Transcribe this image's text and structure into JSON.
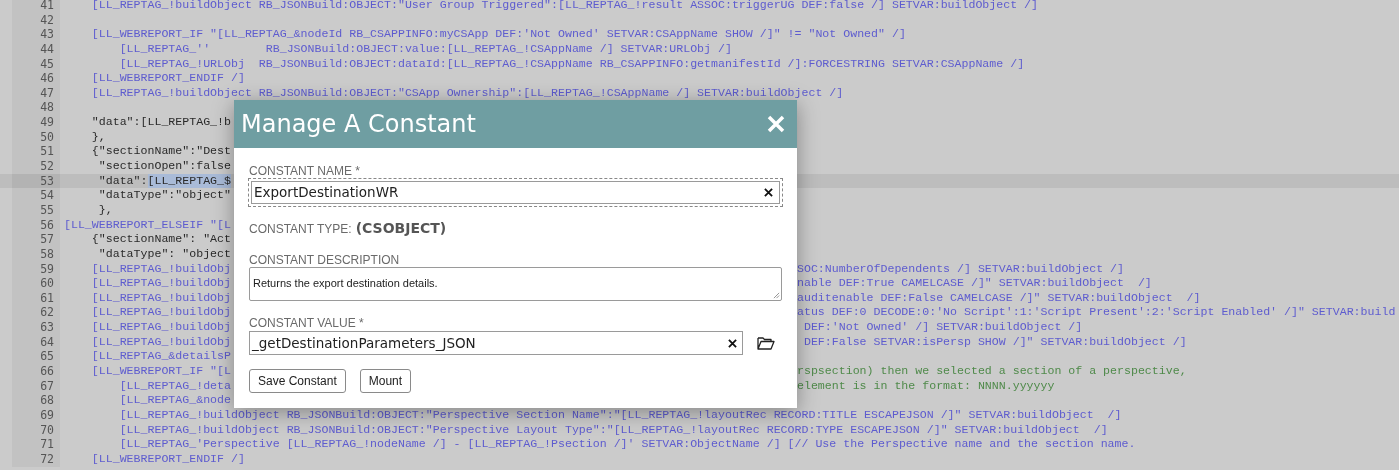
{
  "editor": {
    "lines": [
      {
        "number": "41",
        "highlighted": false,
        "kind": "tag",
        "text": "    [LL_REPTAG_!buildObject RB_JSONBuild:OBJECT:\"User Group Triggered\":[LL_REPTAG_!result ASSOC:triggerUG DEF:false /] SETVAR:buildObject /]"
      },
      {
        "number": "42",
        "highlighted": false
      },
      {
        "number": "43",
        "highlighted": false,
        "kind": "tag",
        "text": "    [LL_WEBREPORT_IF \"[LL_REPTAG_&nodeId RB_CSAPPINFO:myCSApp DEF:'Not Owned' SETVAR:CSAppName SHOW /]\" != \"Not Owned\" /]"
      },
      {
        "number": "44",
        "highlighted": false,
        "kind": "tag",
        "text": "        [LL_REPTAG_''        RB_JSONBuild:OBJECT:value:[LL_REPTAG_!CSAppName /] SETVAR:URLObj /]"
      },
      {
        "number": "45",
        "highlighted": false,
        "kind": "tag",
        "text": "        [LL_REPTAG_!URLObj  RB_JSONBuild:OBJECT:dataId:[LL_REPTAG_!CSAppName RB_CSAPPINFO:getmanifestId /]:FORCESTRING SETVAR:CSAppName /]"
      },
      {
        "number": "46",
        "highlighted": false,
        "kind": "tag",
        "text": "    [LL_WEBREPORT_ENDIF /]"
      },
      {
        "number": "47",
        "highlighted": false,
        "kind": "tag",
        "text": "    [LL_REPTAG_!buildObject RB_JSONBuild:OBJECT:\"CSApp Ownership\":[LL_REPTAG_!CSAppName /] SETVAR:buildObject /]"
      },
      {
        "number": "48",
        "highlighted": false
      },
      {
        "number": "49",
        "highlighted": false,
        "kind": "json",
        "text": "    \"data\":[LL_REPTAG_!b"
      },
      {
        "number": "50",
        "highlighted": false,
        "kind": "json",
        "text": "    },"
      },
      {
        "number": "51",
        "highlighted": false,
        "kind": "json",
        "text": "    {\"sectionName\":\"Dest"
      },
      {
        "number": "52",
        "highlighted": false,
        "kind": "json",
        "text": "     \"sectionOpen\":false"
      },
      {
        "number": "53",
        "highlighted": true,
        "kind": "json",
        "text": "     \"data\":",
        "selection": "[LL_REPTAG_$"
      },
      {
        "number": "54",
        "highlighted": false,
        "kind": "json",
        "text": "     \"dataType\":\"object\""
      },
      {
        "number": "55",
        "highlighted": false,
        "kind": "json",
        "text": "     },"
      },
      {
        "number": "56",
        "highlighted": false,
        "kind": "tag",
        "text": "[LL_WEBREPORT_ELSEIF \"[L"
      },
      {
        "number": "57",
        "highlighted": false,
        "kind": "json",
        "text": "    {\"sectionName\": \"Act"
      },
      {
        "number": "58",
        "highlighted": false,
        "kind": "json",
        "text": "     \"dataType\": \"object"
      },
      {
        "number": "59",
        "highlighted": false,
        "kind": "tag",
        "text": "    [LL_REPTAG_!buildObj",
        "right": {
          "kind": "tag",
          "text": "SOC:NumberOfDependents /] SETVAR:buildObject /]"
        }
      },
      {
        "number": "60",
        "highlighted": false,
        "kind": "tag",
        "text": "    [LL_REPTAG_!buildObj",
        "right": {
          "kind": "tag",
          "text": "nable DEF:True CAMELCASE /]\" SETVAR:buildObject  /]"
        }
      },
      {
        "number": "61",
        "highlighted": false,
        "kind": "tag",
        "text": "    [LL_REPTAG_!buildObj",
        "right": {
          "kind": "tag",
          "text": "auditenable DEF:False CAMELCASE /]\" SETVAR:buildObject  /]"
        }
      },
      {
        "number": "62",
        "highlighted": false,
        "kind": "tag",
        "text": "    [LL_REPTAG_!buildObj",
        "right": {
          "kind": "tag",
          "text": "atus DEF:0 DECODE:0:'No Script':1:'Script Present':2:'Script Enabled' /]\" SETVAR:build"
        }
      },
      {
        "number": "63",
        "highlighted": false,
        "kind": "tag",
        "text": "    [LL_REPTAG_!buildObj",
        "right": {
          "kind": "tag",
          "text": " DEF:'Not Owned' /] SETVAR:buildObject /]"
        }
      },
      {
        "number": "64",
        "highlighted": false,
        "kind": "tag",
        "text": "    [LL_REPTAG_!buildObj",
        "right": {
          "kind": "tag",
          "text": " DEF:False SETVAR:isPersp SHOW /]\" SETVAR:buildObject /]"
        }
      },
      {
        "number": "65",
        "highlighted": false,
        "kind": "tag",
        "text": "    [LL_REPTAG_&detailsP"
      },
      {
        "number": "66",
        "highlighted": false,
        "kind": "tag",
        "text": "    [LL_WEBREPORT_IF \"[L",
        "right": {
          "kind": "comment",
          "text": "rspsection) then we selected a section of a perspective,"
        }
      },
      {
        "number": "67",
        "highlighted": false,
        "kind": "tag",
        "text": "        [LL_REPTAG_!deta",
        "right": {
          "kind": "comment",
          "text": "element is in the format: NNNN.yyyyyy"
        }
      },
      {
        "number": "68",
        "highlighted": false,
        "kind": "tag",
        "text": "        [LL_REPTAG_&node"
      },
      {
        "number": "69",
        "highlighted": false,
        "kind": "tag",
        "text": "        [LL_REPTAG_!buildObject RB_JSONBuild:OBJECT:\"Perspective Section Name\":\"[LL_REPTAG_!layoutRec RECORD:TITLE ESCAPEJSON /]\" SETVAR:buildObject  /]"
      },
      {
        "number": "70",
        "highlighted": false,
        "kind": "tag",
        "text": "        [LL_REPTAG_!buildObject RB_JSONBuild:OBJECT:\"Perspective Layout Type\":\"[LL_REPTAG_!layoutRec RECORD:TYPE ESCAPEJSON /]\" SETVAR:buildObject  /]"
      },
      {
        "number": "71",
        "highlighted": false,
        "kind": "tag",
        "text": "        [LL_REPTAG_'Perspective [LL_REPTAG_!nodeName /] - [LL_REPTAG_!Psection /]' SETVAR:ObjectName /] [// Use the Perspective name and the section name."
      },
      {
        "number": "72",
        "highlighted": false,
        "kind": "tag",
        "text": "    [LL_WEBREPORT_ENDIF /]"
      }
    ]
  },
  "dialog": {
    "title": "Manage A Constant",
    "name_field": {
      "label": "CONSTANT NAME *",
      "value": "ExportDestinationWR",
      "focused": true
    },
    "type": {
      "label": "CONSTANT TYPE:",
      "value": "(CSOBJECT)"
    },
    "description_field": {
      "label": "CONSTANT DESCRIPTION",
      "value": "Returns the export destination details."
    },
    "value_field": {
      "label": "CONSTANT VALUE *",
      "value": "_getDestinationParameters_JSON"
    },
    "buttons": [
      "Save Constant",
      "Mount"
    ]
  }
}
